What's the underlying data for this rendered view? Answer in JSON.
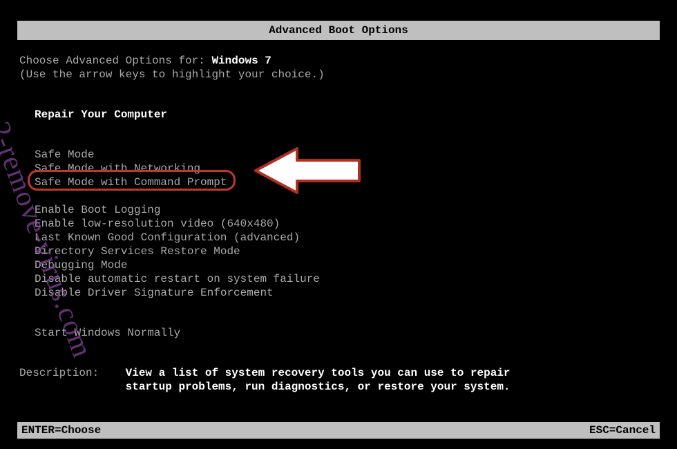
{
  "title": "Advanced Boot Options",
  "choose_prefix": "Choose Advanced Options for: ",
  "os_name": "Windows 7",
  "arrow_hint": "(Use the arrow keys to highlight your choice.)",
  "repair": "Repair Your Computer",
  "options": {
    "safe": "Safe Mode",
    "net": "Safe Mode with Networking",
    "cmd": "Safe Mode with Command Prompt",
    "bootlog": "Enable Boot Logging",
    "lowres": "Enable low-resolution video (640x480)",
    "lkg": "Last Known Good Configuration (advanced)",
    "dsrm": "Directory Services Restore Mode",
    "debug": "Debugging Mode",
    "noauto": "Disable automatic restart on system failure",
    "nodrvsig": "Disable Driver Signature Enforcement",
    "normal": "Start Windows Normally"
  },
  "desc_label": "Description:",
  "desc_text1": "View a list of system recovery tools you can use to repair",
  "desc_text2": "startup problems, run diagnostics, or restore your system.",
  "status": {
    "enter": "ENTER=Choose",
    "esc": "ESC=Cancel"
  },
  "watermark": "2-remove-virus.com"
}
